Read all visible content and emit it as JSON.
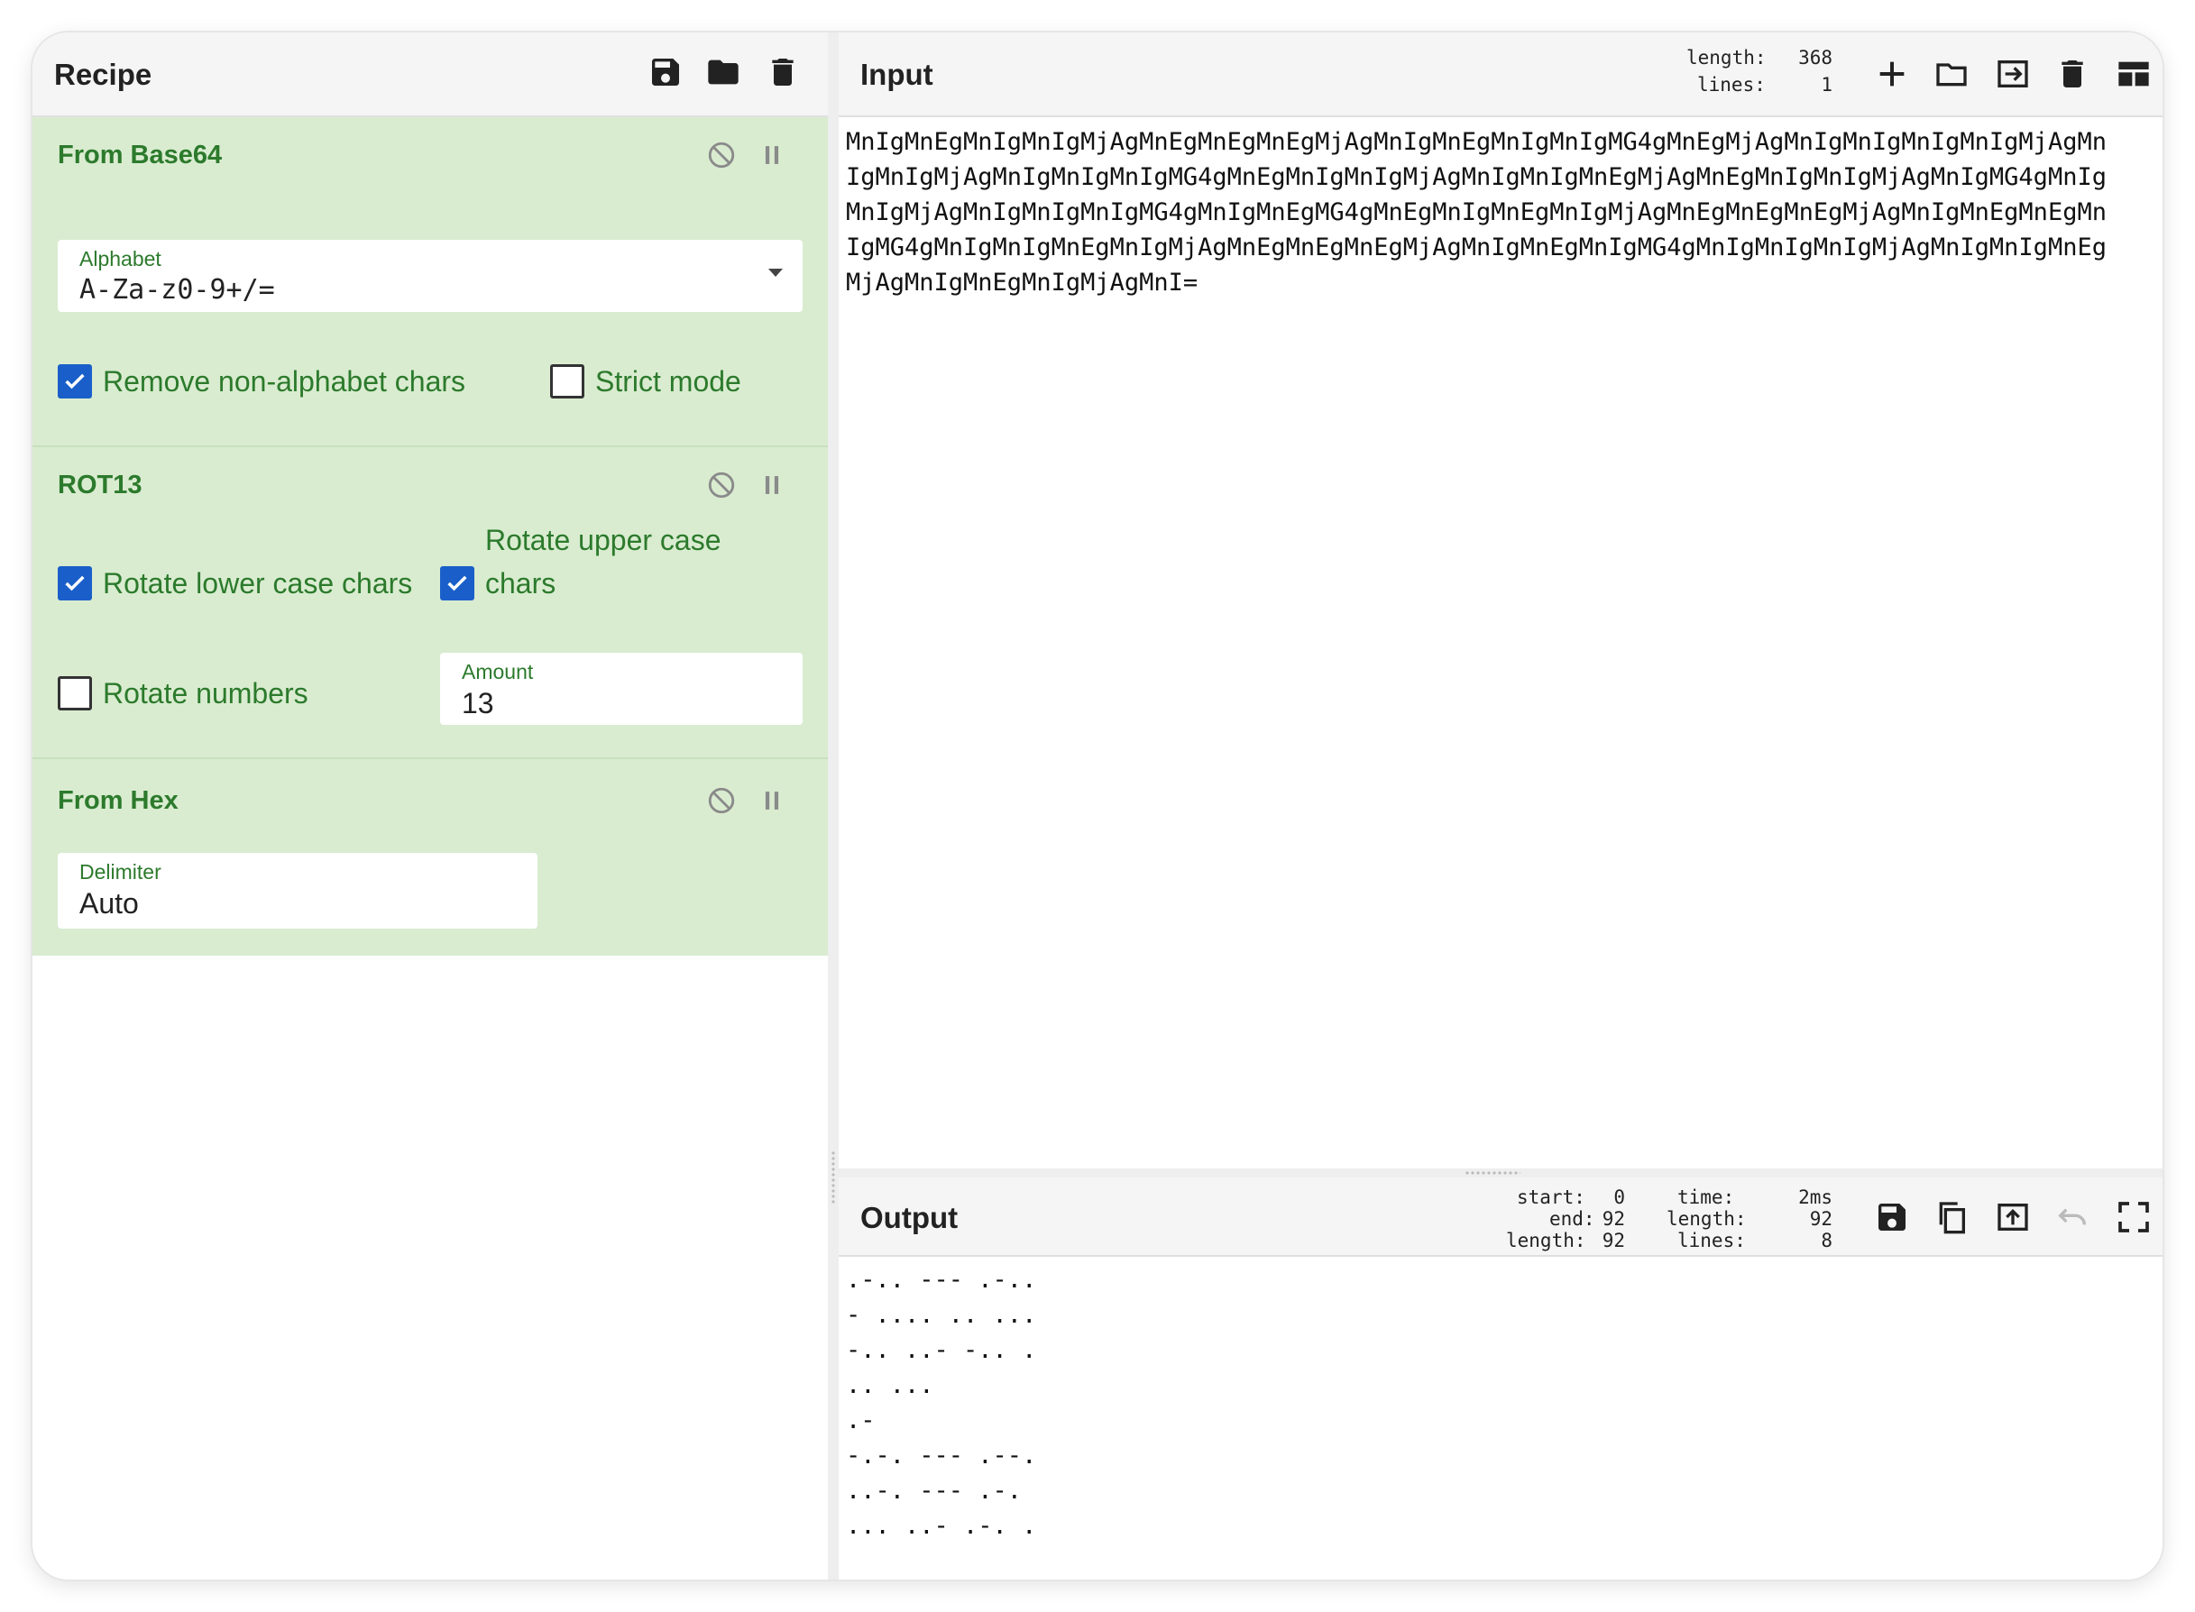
{
  "recipe": {
    "title": "Recipe",
    "icons": [
      "save-icon",
      "folder-icon",
      "trash-icon"
    ],
    "operations": [
      {
        "title": "From Base64",
        "alphabet": {
          "label": "Alphabet",
          "value": "A-Za-z0-9+/="
        },
        "remove_non_alphabet": {
          "label": "Remove non-alphabet chars",
          "checked": true
        },
        "strict_mode": {
          "label": "Strict mode",
          "checked": false
        }
      },
      {
        "title": "ROT13",
        "rotate_lower": {
          "label": "Rotate lower case chars",
          "checked": true
        },
        "rotate_upper": {
          "label_line1": "Rotate upper case",
          "label_line2": "chars",
          "checked": true
        },
        "rotate_numbers": {
          "label": "Rotate numbers",
          "checked": false
        },
        "amount": {
          "label": "Amount",
          "value": "13"
        }
      },
      {
        "title": "From Hex",
        "delimiter": {
          "label": "Delimiter",
          "value": "Auto"
        }
      }
    ]
  },
  "input": {
    "title": "Input",
    "stats": {
      "length_label": "length:",
      "length": "368",
      "lines_label": "lines:",
      "lines": "1"
    },
    "lines": [
      "MnIgMnEgMnIgMnIgMjAgMnEgMnEgMnEgMjAgMnIgMnEgMnIgMnIgMG4gMnEgMjAgMnIgMnIgMnIgMnIgMjAgMn",
      "IgMnIgMjAgMnIgMnIgMnIgMG4gMnEgMnIgMnIgMjAgMnIgMnIgMnEgMjAgMnEgMnIgMnIgMjAgMnIgMG4gMnIg",
      "MnIgMjAgMnIgMnIgMnIgMG4gMnIgMnEgMG4gMnEgMnIgMnEgMnIgMjAgMnEgMnEgMnEgMjAgMnIgMnEgMnEgMn",
      "IgMG4gMnIgMnIgMnEgMnIgMjAgMnEgMnEgMnEgMjAgMnIgMnEgMnIgMG4gMnIgMnIgMnIgMjAgMnIgMnIgMnEg",
      "MjAgMnIgMnEgMnIgMjAgMnI="
    ]
  },
  "output": {
    "title": "Output",
    "stats": {
      "start_label": "start:",
      "start": "0",
      "end_label": "end:",
      "end": "92",
      "sel_length_label": "length:",
      "sel_length": "92",
      "time_label": "time:",
      "time": "2ms",
      "length_label": "length:",
      "length": "92",
      "lines_label": "lines:",
      "lines": "8"
    },
    "lines": [
      ".-.. --- .-..",
      "- .... .. ...",
      "-.. ..- -.. .",
      ".. ...",
      ".-",
      "-.-. --- .--.",
      "..-. --- .-.",
      "... ..- .-. ."
    ]
  }
}
